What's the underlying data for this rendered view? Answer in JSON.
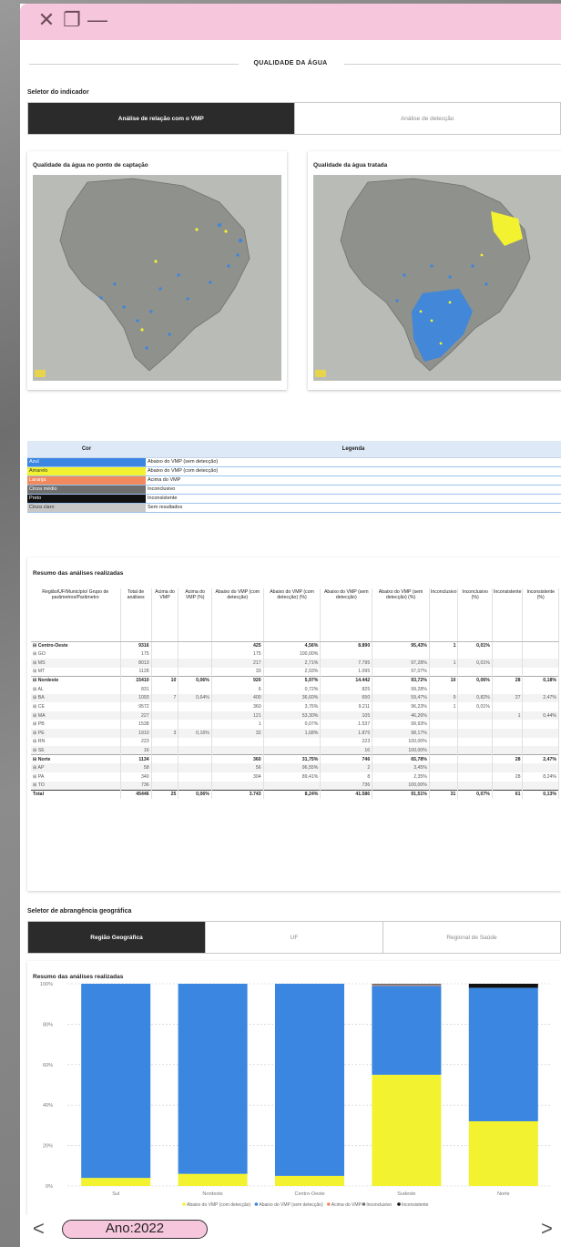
{
  "window": {
    "controls": {
      "close": "✕",
      "restore": "❐",
      "minimize": "—"
    }
  },
  "report": {
    "title": "QUALIDADE DA ÁGUA",
    "indicator_selector": {
      "label": "Seletor do indicador",
      "options": [
        "Análise de relação com o VMP",
        "Análise de detecção"
      ],
      "selected": "Análise de relação com o VMP"
    },
    "maps": [
      {
        "title": "Qualidade da água no ponto de captação"
      },
      {
        "title": "Qualidade da água tratada"
      }
    ],
    "color_legend": {
      "headers": [
        "Cor",
        "Legenda"
      ],
      "rows": [
        {
          "name": "Azul",
          "color": "#3a86e0",
          "desc": "Abaixo do VMP (sem detecção)"
        },
        {
          "name": "Amarelo",
          "color": "#f2f230",
          "desc": "Abaixo do VMP (com detecção)"
        },
        {
          "name": "Laranja",
          "color": "#f08a5e",
          "desc": "Acima do VMP"
        },
        {
          "name": "Cinza médio",
          "color": "#6e6e6e",
          "desc": "Inconclusivo"
        },
        {
          "name": "Preto",
          "color": "#111111",
          "desc": "Inconsistente"
        },
        {
          "name": "Cinza claro",
          "color": "#c8c8c8",
          "desc": "Sem resultados"
        }
      ]
    },
    "summary_table": {
      "title": "Resumo das análises realizadas",
      "headers": [
        "Região/UF/Município/ Grupo de parâmetros/Parâmetro",
        "Total de análises",
        "Acima do VMP",
        "Acima do VMP (%)",
        "Abaixo do VMP (com detecção)",
        "Abaixo do VMP (com detecção) (%)",
        "Abaixo do VMP (sem detecção)",
        "Abaixo do VMP (sem detecção) (%)",
        "Inconclusivo",
        "Inconclusivo (%)",
        "Inconsistente",
        "Inconsistente (%)"
      ],
      "rows": [
        {
          "kind": "grp",
          "cells": [
            "⊟ Centro-Oeste",
            "9316",
            "",
            "",
            "425",
            "4,56%",
            "8.890",
            "95,43%",
            "1",
            "0,01%",
            "",
            ""
          ]
        },
        {
          "kind": "sub",
          "cells": [
            "⊞ GO",
            "175",
            "",
            "",
            "175",
            "100,00%",
            "",
            "",
            "",
            "",
            "",
            ""
          ]
        },
        {
          "kind": "sub",
          "cells": [
            "⊞ MS",
            "8013",
            "",
            "",
            "217",
            "2,71%",
            "7.795",
            "97,28%",
            "1",
            "0,01%",
            "",
            ""
          ]
        },
        {
          "kind": "sub",
          "cells": [
            "⊞ MT",
            "1128",
            "",
            "",
            "33",
            "2,93%",
            "1.095",
            "97,07%",
            "",
            "",
            "",
            ""
          ]
        },
        {
          "kind": "grp",
          "cells": [
            "⊟ Nordeste",
            "15410",
            "10",
            "0,06%",
            "920",
            "5,97%",
            "14.442",
            "93,72%",
            "10",
            "0,06%",
            "28",
            "0,18%"
          ]
        },
        {
          "kind": "sub",
          "cells": [
            "⊞ AL",
            "831",
            "",
            "",
            "6",
            "0,72%",
            "825",
            "99,28%",
            "",
            "",
            "",
            ""
          ]
        },
        {
          "kind": "sub",
          "cells": [
            "⊞ BA",
            "1093",
            "7",
            "0,64%",
            "400",
            "36,60%",
            "650",
            "59,47%",
            "9",
            "0,82%",
            "27",
            "2,47%"
          ]
        },
        {
          "kind": "sub",
          "cells": [
            "⊞ CE",
            "9572",
            "",
            "",
            "360",
            "3,76%",
            "9.211",
            "96,23%",
            "1",
            "0,01%",
            "",
            ""
          ]
        },
        {
          "kind": "sub",
          "cells": [
            "⊞ MA",
            "227",
            "",
            "",
            "121",
            "53,30%",
            "105",
            "46,26%",
            "",
            "",
            "1",
            "0,44%"
          ]
        },
        {
          "kind": "sub",
          "cells": [
            "⊞ PB",
            "1538",
            "",
            "",
            "1",
            "0,07%",
            "1.537",
            "99,93%",
            "",
            "",
            "",
            ""
          ]
        },
        {
          "kind": "sub",
          "cells": [
            "⊞ PE",
            "1910",
            "3",
            "0,16%",
            "32",
            "1,68%",
            "1.875",
            "98,17%",
            "",
            "",
            "",
            ""
          ]
        },
        {
          "kind": "sub",
          "cells": [
            "⊞ RN",
            "223",
            "",
            "",
            "",
            "",
            "223",
            "100,00%",
            "",
            "",
            "",
            ""
          ]
        },
        {
          "kind": "sub",
          "cells": [
            "⊞ SE",
            "16",
            "",
            "",
            "",
            "",
            "16",
            "100,00%",
            "",
            "",
            "",
            ""
          ]
        },
        {
          "kind": "grp",
          "cells": [
            "⊟ Norte",
            "1134",
            "",
            "",
            "360",
            "31,75%",
            "746",
            "65,78%",
            "",
            "",
            "28",
            "2,47%"
          ]
        },
        {
          "kind": "sub",
          "cells": [
            "⊞ AP",
            "58",
            "",
            "",
            "56",
            "96,55%",
            "2",
            "3,45%",
            "",
            "",
            "",
            ""
          ]
        },
        {
          "kind": "sub",
          "cells": [
            "⊞ PA",
            "340",
            "",
            "",
            "304",
            "89,41%",
            "8",
            "2,35%",
            "",
            "",
            "28",
            "8,24%"
          ]
        },
        {
          "kind": "sub",
          "cells": [
            "⊞ TO",
            "736",
            "",
            "",
            "",
            "",
            "736",
            "100,00%",
            "",
            "",
            "",
            ""
          ]
        }
      ],
      "total": [
        "Total",
        "45446",
        "25",
        "0,06%",
        "3.743",
        "8,24%",
        "41.586",
        "91,51%",
        "31",
        "0,07%",
        "61",
        "0,13%"
      ]
    },
    "geo_selector": {
      "label": "Seletor de abrangência geográfica",
      "options": [
        "Região Geográfica",
        "UF",
        "Regional de Saúde"
      ],
      "selected": "Região Geográfica"
    },
    "chart_title": "Resumo das análises realizadas"
  },
  "chart_data": {
    "type": "bar",
    "stacked": true,
    "categories": [
      "Sul",
      "Nordeste",
      "Centro-Oeste",
      "Sudeste",
      "Norte"
    ],
    "series": [
      {
        "name": "Abaixo do VMP (com detecção)",
        "color": "#f2f230",
        "values": [
          4,
          6,
          5,
          55,
          32
        ]
      },
      {
        "name": "Abaixo do VMP (sem detecção)",
        "color": "#3a86e0",
        "values": [
          96,
          94,
          95,
          44,
          66
        ]
      },
      {
        "name": "Acima do VMP",
        "color": "#f08a5e",
        "values": [
          0,
          0,
          0,
          0.3,
          0
        ]
      },
      {
        "name": "Inconclusivo",
        "color": "#6e6e6e",
        "values": [
          0,
          0,
          0,
          0.7,
          0
        ]
      },
      {
        "name": "Inconsistente",
        "color": "#111111",
        "values": [
          0,
          0,
          0,
          0,
          2
        ]
      }
    ],
    "yticks": [
      "0%",
      "20%",
      "40%",
      "60%",
      "80%",
      "100%"
    ],
    "ylim": [
      0,
      100
    ],
    "grid": true,
    "legend": "bottom"
  },
  "bottom_bar": {
    "prev": "<",
    "next": ">",
    "year_filter": "Ano:2022"
  }
}
